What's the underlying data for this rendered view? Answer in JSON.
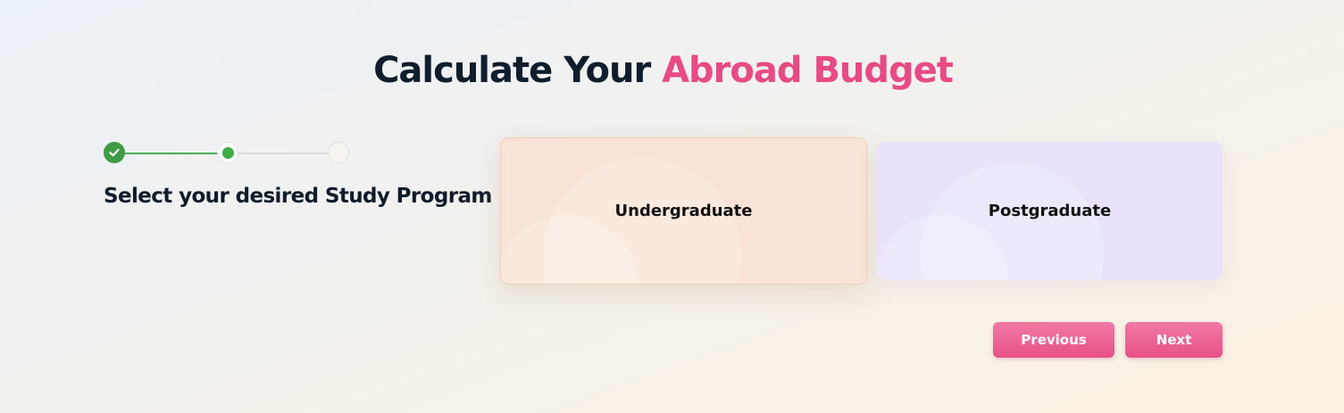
{
  "header": {
    "title_main": "Calculate Your ",
    "title_accent": "Abroad Budget"
  },
  "stepper": {
    "total_steps": 3,
    "current_step": 2,
    "completed_steps": 1,
    "step_label": "Select your desired Study Program"
  },
  "options": [
    {
      "label": "Undergraduate",
      "selected": true
    },
    {
      "label": "Postgraduate",
      "selected": false
    }
  ],
  "actions": {
    "previous_label": "Previous",
    "next_label": "Next"
  },
  "colors": {
    "accent": "#e84a84",
    "success": "#3f9c44",
    "undergraduate_card": "#f9e3d6",
    "postgraduate_card": "#eae2fa",
    "button": "#e85088"
  },
  "icons": {
    "completed_step": "check-icon"
  }
}
